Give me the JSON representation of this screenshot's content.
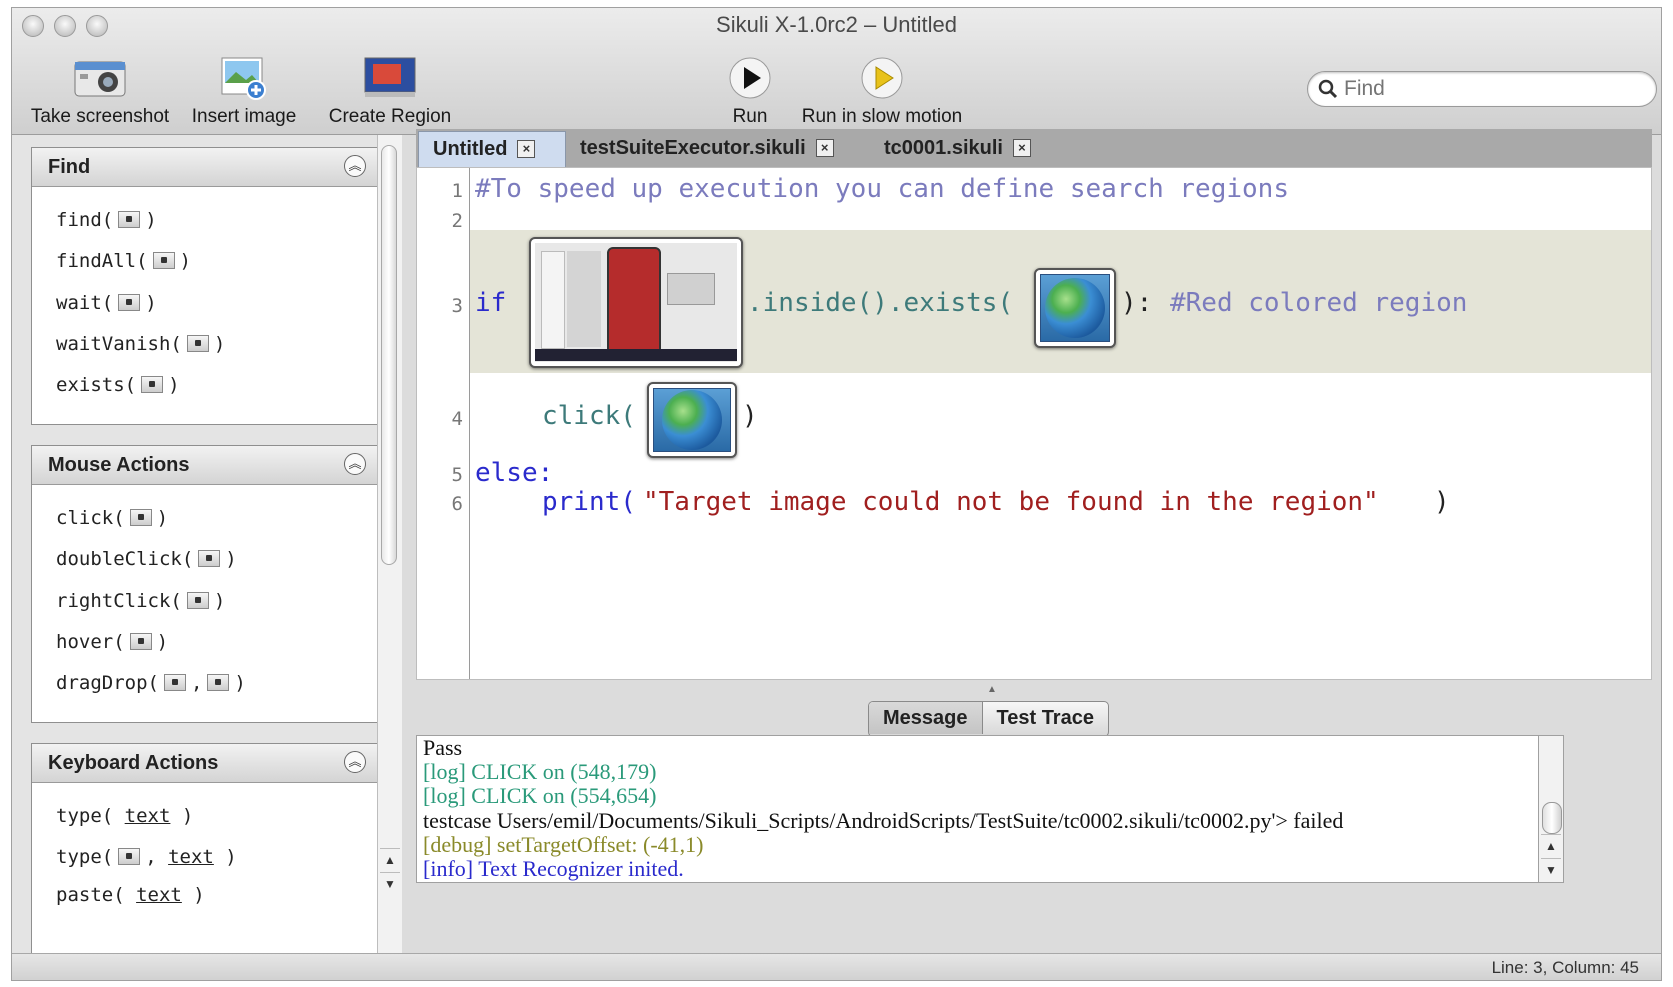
{
  "window": {
    "title": "Sikuli X-1.0rc2 – Untitled"
  },
  "toolbar": {
    "take_screenshot": "Take screenshot",
    "insert_image": "Insert image",
    "create_region": "Create Region",
    "run": "Run",
    "run_slow": "Run in slow motion"
  },
  "search": {
    "placeholder": "Find"
  },
  "sidebar": {
    "find": {
      "title": "Find",
      "items": [
        "find(",
        "findAll(",
        "wait(",
        "waitVanish(",
        "exists("
      ]
    },
    "mouse": {
      "title": "Mouse Actions",
      "items": [
        "click(",
        "doubleClick(",
        "rightClick(",
        "hover(",
        "dragDrop("
      ]
    },
    "keyboard": {
      "title": "Keyboard Actions",
      "items": [
        "type(",
        "type(",
        "paste("
      ],
      "text_arg": "text"
    }
  },
  "tabs": [
    "Untitled",
    "testSuiteExecutor.sikuli",
    "tc0001.sikuli"
  ],
  "editor": {
    "line_numbers": [
      "1",
      "2",
      "3",
      "4",
      "5",
      "6"
    ],
    "line1": "#To speed up execution you can define search regions",
    "line3_if": "if",
    "line3_mid": ".inside().exists(",
    "line3_close": "):",
    "line3_comment": "#Red colored region",
    "line4_fn": "click(",
    "line4_close": ")",
    "line5": "else:",
    "line6_fn": "print(",
    "line6_str": "\"Target image could not be found in the region\"",
    "line6_close": ")"
  },
  "console_tabs": {
    "message": "Message",
    "trace": "Test Trace"
  },
  "console": [
    {
      "text": "Pass",
      "color": "#111111"
    },
    {
      "text": "[log] CLICK on (548,179)",
      "color": "#2a9a7a"
    },
    {
      "text": "[log] CLICK on (554,654)",
      "color": "#2a9a7a"
    },
    {
      "text": "testcase Users/emil/Documents/Sikuli_Scripts/AndroidScripts/TestSuite/tc0002.sikuli/tc0002.py'> failed",
      "color": "#111111"
    },
    {
      "text": "[debug] setTargetOffset: (-41,1)",
      "color": "#8a8a2a"
    },
    {
      "text": "[info] Text Recognizer inited.",
      "color": "#2a2acc"
    }
  ],
  "status": {
    "text": "Line: 3, Column: 45"
  }
}
